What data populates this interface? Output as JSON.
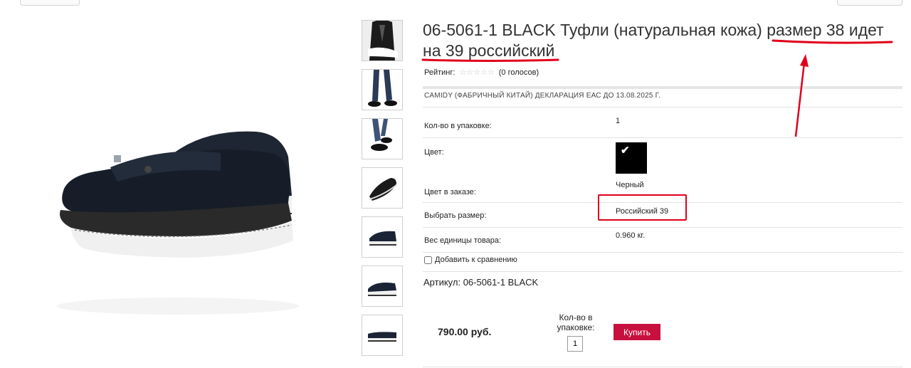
{
  "product": {
    "title_part1": "06-5061-1 BLACK Туфли (натуральная кожа)",
    "title_highlight_line1": "размер 38 идет",
    "title_highlight_line2": "на 39 российский",
    "rating_label": "Рейтинг:",
    "rating_stars": "☆☆☆☆☆",
    "rating_votes": "(0 голосов)",
    "manufacturer": "CAMIDY (ФАБРИЧНЫЙ КИТАЙ) ДЕКЛАРАЦИЯ ЕАС ДО 13.08.2025 Г."
  },
  "params": [
    {
      "label": "Кол-во в упаковке:",
      "value": "1"
    },
    {
      "label": "Цвет:",
      "value": ""
    },
    {
      "label": "Цвет в заказе:",
      "value": "Черный"
    },
    {
      "label": "Выбрать размер:",
      "value": "Российский 39"
    },
    {
      "label": "Вес единицы товара:",
      "value": "0.960 кг."
    }
  ],
  "color_swatch": {
    "color": "#000000",
    "check": "✔"
  },
  "compare_label": "Добавить к сравнению",
  "article": "Артикул: 06-5061-1 BLACK",
  "buy": {
    "price": "790.00 руб.",
    "qty_label": "Кол-во в упаковке:",
    "qty_value": "1",
    "button_label": "Купить"
  },
  "colors": {
    "buy_button": "#c8103e",
    "annotation_red": "#e0001a"
  }
}
